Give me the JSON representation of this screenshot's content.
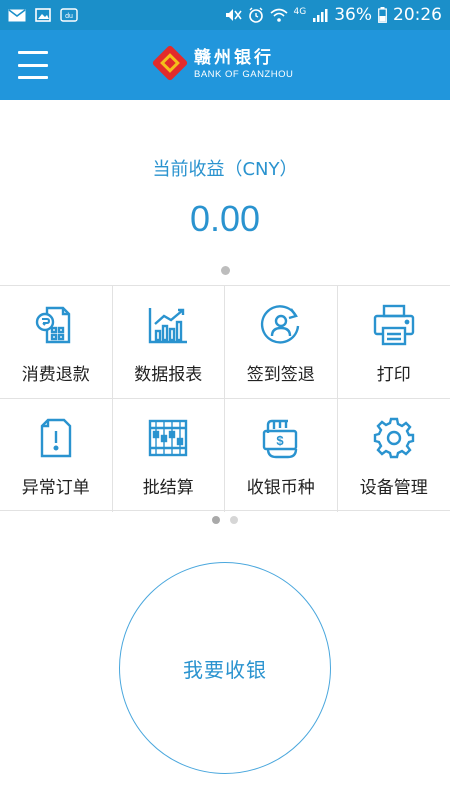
{
  "status_bar": {
    "battery": "36%",
    "time": "20:26",
    "network": "4G",
    "icons": [
      "mail-icon",
      "image-icon",
      "notification-icon",
      "mute-icon",
      "alarm-icon",
      "wifi-icon",
      "signal-icon",
      "battery-icon"
    ]
  },
  "app_bar": {
    "brand_cn": "赣州银行",
    "brand_en": "BANK OF GANZHOU"
  },
  "earnings": {
    "label": "当前收益（CNY）",
    "value": "0.00"
  },
  "menu": [
    {
      "label": "消费退款",
      "icon": "refund-icon"
    },
    {
      "label": "数据报表",
      "icon": "chart-icon"
    },
    {
      "label": "签到签退",
      "icon": "sign-in-icon"
    },
    {
      "label": "打印",
      "icon": "printer-icon"
    },
    {
      "label": "异常订单",
      "icon": "alert-document-icon"
    },
    {
      "label": "批结算",
      "icon": "abacus-icon"
    },
    {
      "label": "收银币种",
      "icon": "currency-icon"
    },
    {
      "label": "设备管理",
      "icon": "gear-icon"
    }
  ],
  "cashier_button": {
    "label": "我要收银"
  },
  "colors": {
    "accent": "#2196dc",
    "status_bar": "#1b8fc9",
    "text_accent": "#2a93cf"
  }
}
